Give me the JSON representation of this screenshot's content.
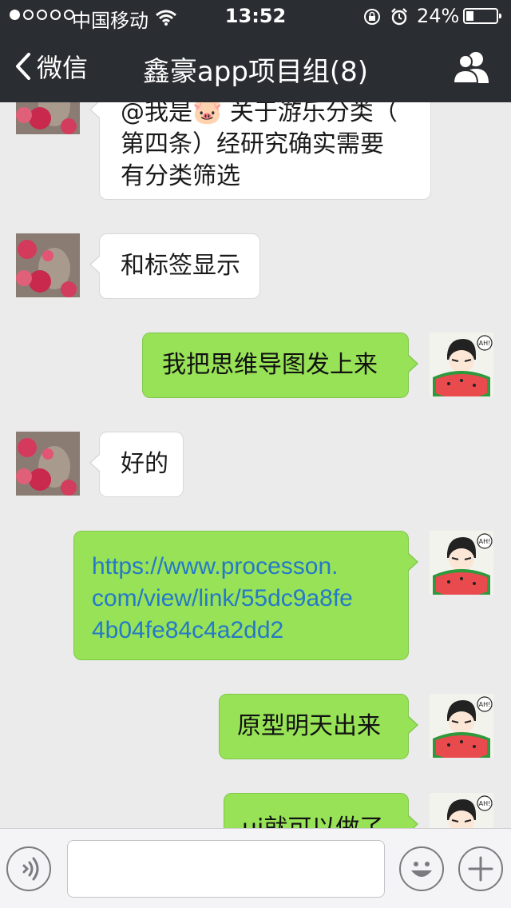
{
  "status_bar": {
    "carrier": "中国移动",
    "time": "13:52",
    "battery": "24%",
    "battery_level": 0.24
  },
  "nav": {
    "back_label": "微信",
    "title": "鑫豪app项目组(8)"
  },
  "messages": [
    {
      "side": "in",
      "text": "@我是🐷 关于游乐分类（\n第四条）经研究确实需要\n有分类筛选"
    },
    {
      "side": "in",
      "text": "和标签显示"
    },
    {
      "side": "out",
      "text": "我把思维导图发上来"
    },
    {
      "side": "in",
      "text": "好的"
    },
    {
      "side": "out",
      "text": "https://www.processon.\ncom/view/link/55dc9a8fe\n4b04fe84c4a2dd2",
      "link": true
    },
    {
      "side": "out",
      "text": "原型明天出来"
    },
    {
      "side": "out",
      "text": "ui就可以做了"
    }
  ],
  "avatar_badge": "AH!",
  "colors": {
    "nav_bg": "#2a2d31",
    "chat_bg": "#ebebeb",
    "bubble_out": "#97e257",
    "bubble_in": "#ffffff",
    "link": "#2579c8"
  },
  "icons": [
    "wifi-icon",
    "lock-rotation-icon",
    "alarm-icon",
    "battery-icon",
    "back-chevron-icon",
    "group-members-icon",
    "voice-icon",
    "emoji-icon",
    "plus-icon"
  ]
}
